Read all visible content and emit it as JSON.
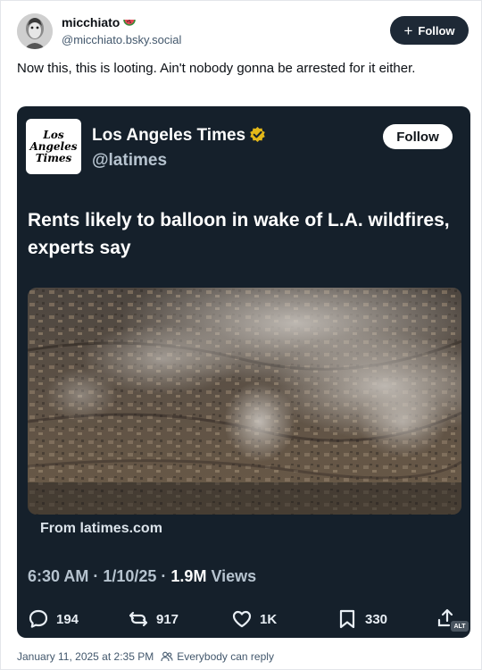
{
  "post": {
    "author_name": "micchiato",
    "author_emoji": "watermelon",
    "author_handle": "@micchiato.bsky.social",
    "follow_label": "Follow",
    "text": "Now this, this is looting. Ain't nobody gonna be arrested for it either.",
    "timestamp": "January 11, 2025 at 2:35 PM",
    "reply_setting": "Everybody can reply"
  },
  "embed": {
    "logo_lines": [
      "Los",
      "Angeles",
      "Times"
    ],
    "account_name": "Los Angeles Times",
    "account_handle": "@latimes",
    "follow_label": "Follow",
    "headline": "Rents likely to balloon in wake of L.A. wildfires, experts say",
    "link_text": "From latimes.com",
    "time": "6:30 AM",
    "date": "1/10/25",
    "views_count": "1.9M",
    "views_label": "Views",
    "replies": "194",
    "reposts": "917",
    "likes": "1K",
    "bookmarks": "330",
    "alt_badge": "ALT"
  },
  "colors": {
    "embed_bg": "#15202b",
    "verified_gold": "#e2b719",
    "follow_dark": "#1e2936"
  }
}
